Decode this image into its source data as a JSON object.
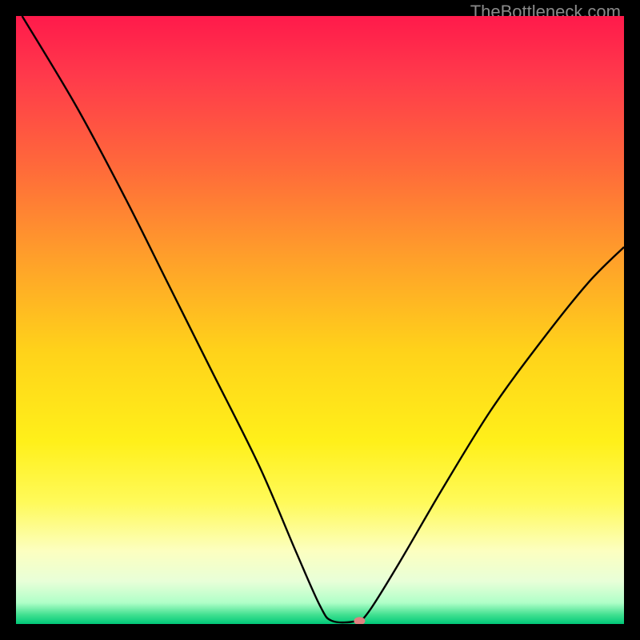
{
  "watermark": "TheBottleneck.com",
  "chart_data": {
    "type": "line",
    "title": "",
    "xlabel": "",
    "ylabel": "",
    "xlim": [
      0,
      100
    ],
    "ylim": [
      0,
      100
    ],
    "background_gradient_stops": [
      {
        "offset": 0.0,
        "color": "#ff1a4b"
      },
      {
        "offset": 0.1,
        "color": "#ff3a4b"
      },
      {
        "offset": 0.25,
        "color": "#ff6a3a"
      },
      {
        "offset": 0.4,
        "color": "#ffa02a"
      },
      {
        "offset": 0.55,
        "color": "#ffd21a"
      },
      {
        "offset": 0.7,
        "color": "#fff01a"
      },
      {
        "offset": 0.8,
        "color": "#fffa5a"
      },
      {
        "offset": 0.88,
        "color": "#fcffc0"
      },
      {
        "offset": 0.93,
        "color": "#e8ffd8"
      },
      {
        "offset": 0.965,
        "color": "#b0ffc8"
      },
      {
        "offset": 0.985,
        "color": "#40e090"
      },
      {
        "offset": 1.0,
        "color": "#00c878"
      }
    ],
    "series": [
      {
        "name": "bottleneck-curve",
        "color": "#000000",
        "points": [
          {
            "x": 1.0,
            "y": 100.0
          },
          {
            "x": 10.0,
            "y": 85.0
          },
          {
            "x": 18.0,
            "y": 70.0
          },
          {
            "x": 25.0,
            "y": 56.0
          },
          {
            "x": 32.0,
            "y": 42.0
          },
          {
            "x": 40.0,
            "y": 26.0
          },
          {
            "x": 46.0,
            "y": 12.0
          },
          {
            "x": 50.0,
            "y": 3.0
          },
          {
            "x": 52.0,
            "y": 0.5
          },
          {
            "x": 56.0,
            "y": 0.5
          },
          {
            "x": 58.0,
            "y": 2.0
          },
          {
            "x": 63.0,
            "y": 10.0
          },
          {
            "x": 70.0,
            "y": 22.0
          },
          {
            "x": 78.0,
            "y": 35.0
          },
          {
            "x": 86.0,
            "y": 46.0
          },
          {
            "x": 94.0,
            "y": 56.0
          },
          {
            "x": 100.0,
            "y": 62.0
          }
        ]
      }
    ],
    "marker": {
      "x": 56.5,
      "y": 0.5,
      "color": "#e08080",
      "rx": 7,
      "ry": 5
    }
  }
}
